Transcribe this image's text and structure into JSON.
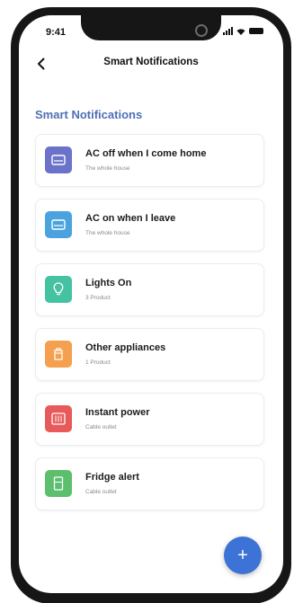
{
  "status_bar": {
    "time": "9:41"
  },
  "nav": {
    "title": "Smart Notifications",
    "back_icon": "chevron-left-icon"
  },
  "section_title": "Smart Notifications",
  "items": [
    {
      "title": "AC off when I come home",
      "subtitle": "The whole house",
      "icon": "ac-unit-icon",
      "color": "#6a72c9"
    },
    {
      "title": "AC on when I leave",
      "subtitle": "The whole house",
      "icon": "ac-unit-icon",
      "color": "#4aa3df"
    },
    {
      "title": "Lights On",
      "subtitle": "3 Product",
      "icon": "light-bulb-icon",
      "color": "#45c2a1"
    },
    {
      "title": "Other appliances",
      "subtitle": "1 Product",
      "icon": "appliance-icon",
      "color": "#f5a04e"
    },
    {
      "title": "Instant power",
      "subtitle": "Cable outlet",
      "icon": "power-grid-icon",
      "color": "#e85a5a"
    },
    {
      "title": "Fridge alert",
      "subtitle": "Cable outlet",
      "icon": "fridge-icon",
      "color": "#5cbf6e"
    }
  ],
  "fab": {
    "label": "+",
    "icon": "plus-icon",
    "color": "#3d72d6"
  }
}
